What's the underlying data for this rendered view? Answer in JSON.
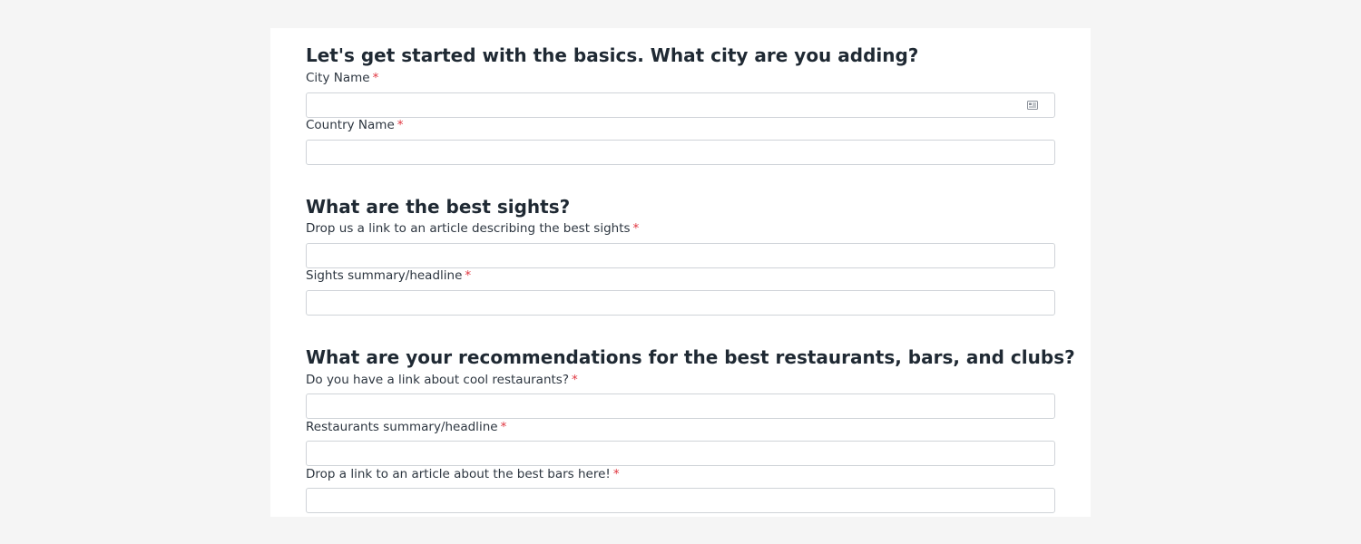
{
  "form": {
    "sections": [
      {
        "heading": "Let's get started with the basics. What city are you adding?",
        "fields": [
          {
            "label": "City Name",
            "required_mark": "*",
            "value": ""
          },
          {
            "label": "Country Name",
            "required_mark": "*",
            "value": ""
          }
        ]
      },
      {
        "heading": "What are the best sights?",
        "fields": [
          {
            "label": "Drop us a link to an article describing the best sights",
            "required_mark": "*",
            "value": ""
          },
          {
            "label": "Sights summary/headline",
            "required_mark": "*",
            "value": ""
          }
        ]
      },
      {
        "heading": "What are your recommendations for the best restaurants, bars, and clubs?",
        "fields": [
          {
            "label": "Do you have a link about cool restaurants?",
            "required_mark": "*",
            "value": ""
          },
          {
            "label": "Restaurants summary/headline",
            "required_mark": "*",
            "value": ""
          },
          {
            "label": "Drop a link to an article about the best bars here!",
            "required_mark": "*",
            "value": ""
          }
        ]
      }
    ],
    "icons": {
      "city_field_icon": "contact-card-icon"
    },
    "colors": {
      "required_asterisk": "#e0353f",
      "page_background": "#f5f5f5",
      "card_background": "#ffffff",
      "input_border": "#cfd3d8"
    }
  }
}
